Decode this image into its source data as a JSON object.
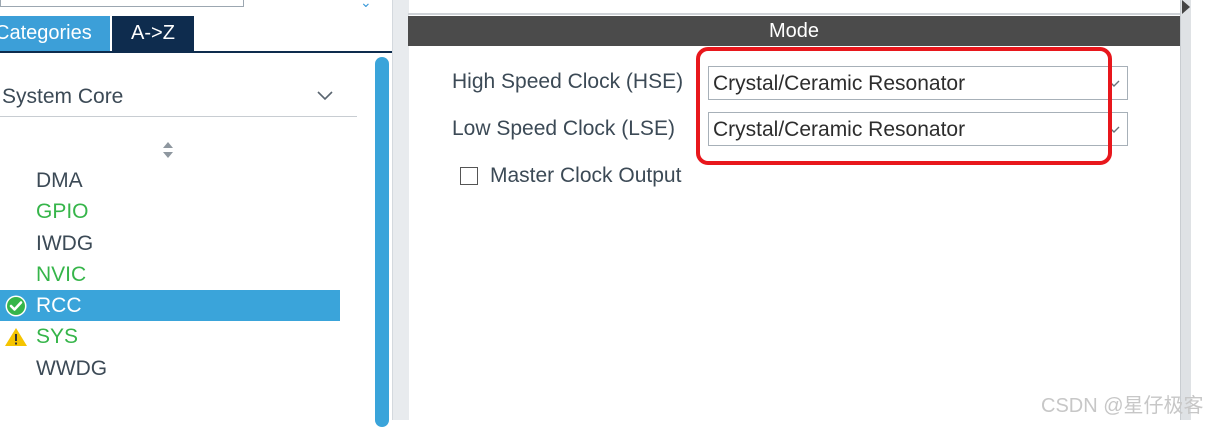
{
  "tabs": {
    "categories": "Categories",
    "az": "A->Z"
  },
  "category_dropdown": {
    "value": "System Core"
  },
  "peripherals": [
    {
      "name": "DMA",
      "color": "#3c4a56",
      "status": ""
    },
    {
      "name": "GPIO",
      "color": "#36b54a",
      "status": ""
    },
    {
      "name": "IWDG",
      "color": "#3c4a56",
      "status": ""
    },
    {
      "name": "NVIC",
      "color": "#36b54a",
      "status": ""
    },
    {
      "name": "RCC",
      "color": "#ffffff",
      "status": "ok",
      "selected": true
    },
    {
      "name": "SYS",
      "color": "#36b54a",
      "status": "warning"
    },
    {
      "name": "WWDG",
      "color": "#3c4a56",
      "status": ""
    }
  ],
  "mode_panel": {
    "header": "Mode",
    "hse": {
      "label": "High Speed Clock (HSE)",
      "value": "Crystal/Ceramic Resonator"
    },
    "lse": {
      "label": "Low Speed Clock (LSE)",
      "value": "Crystal/Ceramic Resonator"
    },
    "master_clock_output": {
      "label": "Master Clock Output",
      "checked": false
    }
  },
  "colors": {
    "accent": "#3aa4da",
    "navy": "#0e2c4e",
    "highlight": "#e8171c",
    "header_bg": "#4b4b4b",
    "ok": "#36b54a",
    "warning": "#f5c400"
  },
  "watermark": "CSDN @星仔极客"
}
